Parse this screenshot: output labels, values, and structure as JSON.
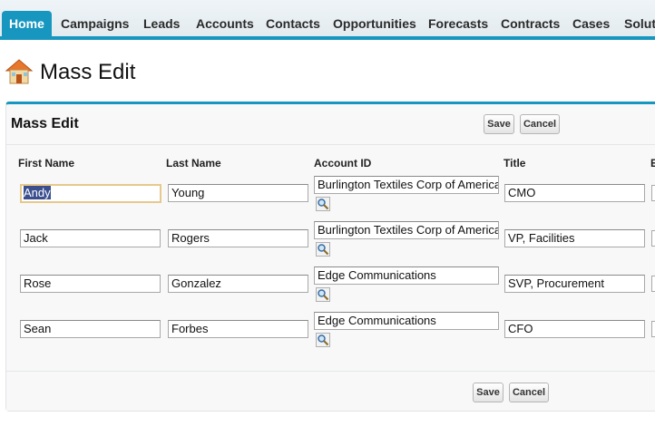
{
  "tabs": [
    "Home",
    "Campaigns",
    "Leads",
    "Accounts",
    "Contacts",
    "Opportunities",
    "Forecasts",
    "Contracts",
    "Cases",
    "Solut"
  ],
  "page": {
    "title": "Mass Edit"
  },
  "panel": {
    "title": "Mass Edit",
    "save_label": "Save",
    "cancel_label": "Cancel"
  },
  "columns": {
    "first_name": "First Name",
    "last_name": "Last Name",
    "account_id": "Account ID",
    "title": "Title",
    "next": "E"
  },
  "rows": [
    {
      "first_name": "Andy",
      "last_name": "Young",
      "account": "Burlington Textiles Corp of America",
      "title": "CMO"
    },
    {
      "first_name": "Jack",
      "last_name": "Rogers",
      "account": "Burlington Textiles Corp of America",
      "title": "VP, Facilities"
    },
    {
      "first_name": "Rose",
      "last_name": "Gonzalez",
      "account": "Edge Communications",
      "title": "SVP, Procurement"
    },
    {
      "first_name": "Sean",
      "last_name": "Forbes",
      "account": "Edge Communications",
      "title": "CFO"
    }
  ],
  "colors": {
    "accent": "#1797c0",
    "focus": "#e6c98c"
  },
  "icons": {
    "page": "house-icon",
    "lookup": "magnifier-icon"
  }
}
